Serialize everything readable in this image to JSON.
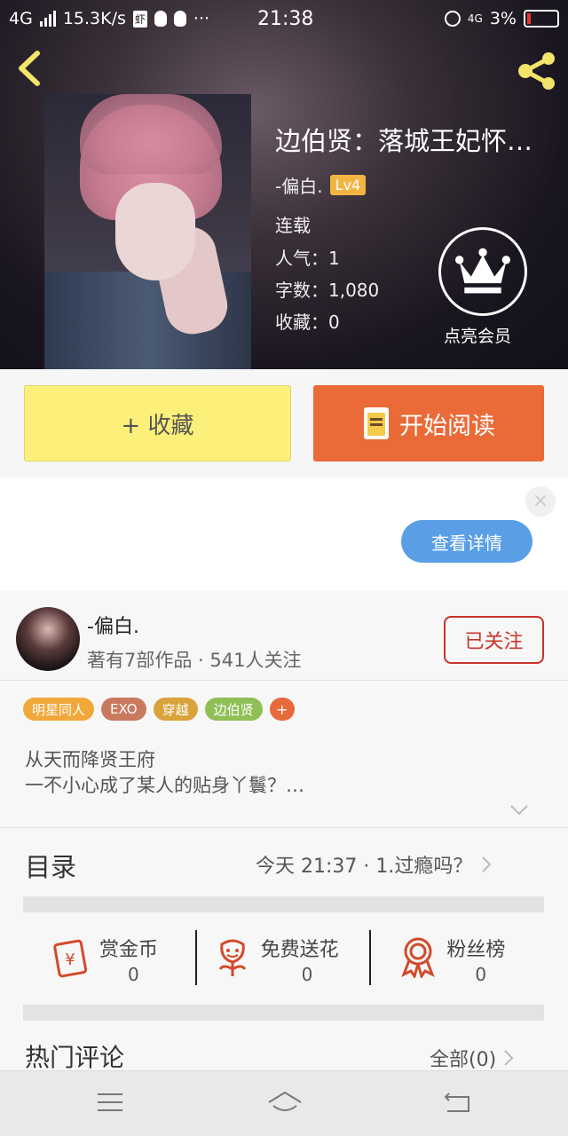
{
  "status_bar": {
    "network": "4G",
    "speed": "15.3K/s",
    "app_badge": "虾",
    "dots": "···",
    "time": "21:38",
    "network_right": "4G",
    "battery": "3%"
  },
  "book": {
    "title": "边伯贤：落城王妃怀…",
    "author": "-偏白.",
    "level": "Lv4",
    "status": "连载",
    "popularity": "人气：1",
    "word_count": "字数：1,080",
    "favorites": "收藏：0",
    "vip_label": "点亮会员"
  },
  "actions": {
    "favorite_label": "+ 收藏",
    "read_label": "开始阅读"
  },
  "ad": {
    "close": "×",
    "details_label": "查看详情"
  },
  "author_card": {
    "name": "-偏白.",
    "info": "著有7部作品 · 541人关注",
    "follow_label": "已关注"
  },
  "tags": [
    {
      "label": "明星同人",
      "color": "#f1a83a"
    },
    {
      "label": "EXO",
      "color": "#c97a5e"
    },
    {
      "label": "穿越",
      "color": "#d9a23a"
    },
    {
      "label": "边伯贤",
      "color": "#8fbf55"
    }
  ],
  "tag_add": "+",
  "description": {
    "line1": "从天而降贤王府",
    "line2": "一不小心成了某人的贴身丫鬟？…"
  },
  "toc": {
    "label": "目录",
    "latest": "今天 21:37 · 1.过瘾吗？"
  },
  "stats": [
    {
      "label": "赏金币",
      "value": "0",
      "icon": "reward-coin-icon"
    },
    {
      "label": "免费送花",
      "value": "0",
      "icon": "flower-icon"
    },
    {
      "label": "粉丝榜",
      "value": "0",
      "icon": "ribbon-badge-icon"
    }
  ],
  "comments": {
    "label": "热门评论",
    "all_label": "全部(0)"
  },
  "colors": {
    "accent_orange": "#ea6a38",
    "fav_yellow": "#fdf07a",
    "follow_red": "#c7342a",
    "link_blue": "#5a9fe6"
  }
}
